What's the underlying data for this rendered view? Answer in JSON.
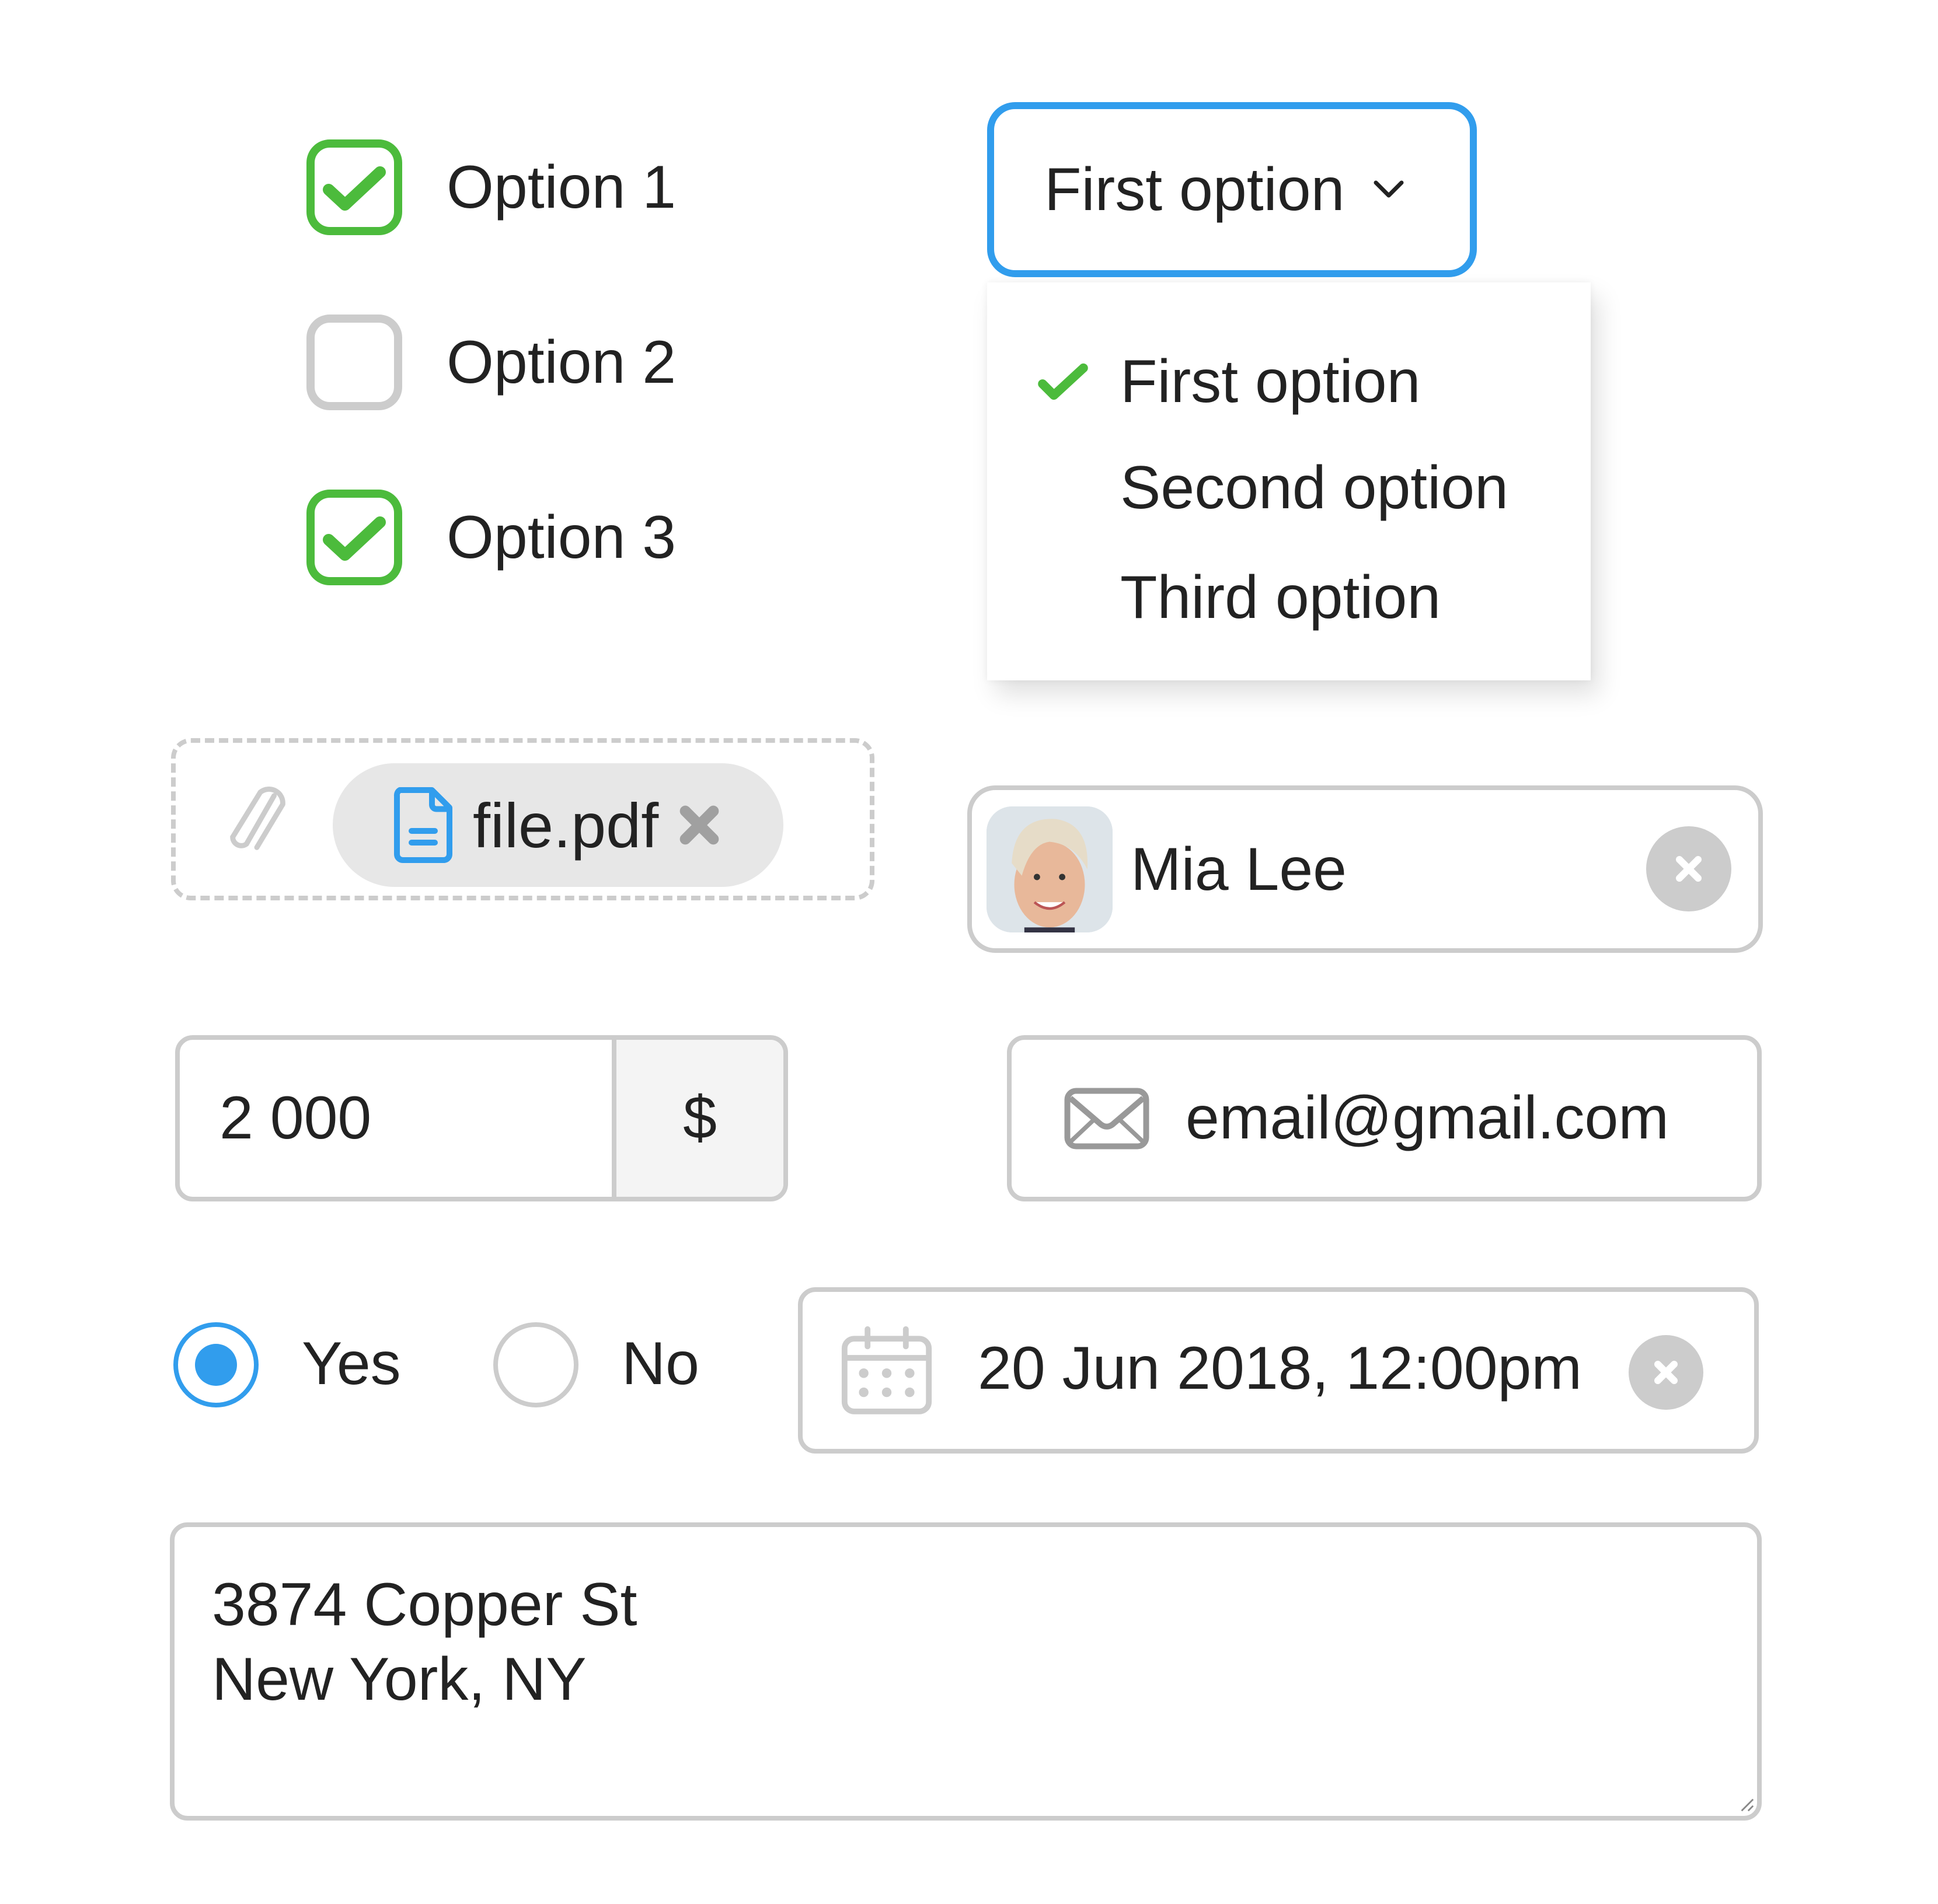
{
  "colors": {
    "accent_blue": "#319ded",
    "check_green": "#4cbb3c",
    "border_gray": "#cccccc",
    "icon_gray": "#999999",
    "chip_bg": "#e7e7e7",
    "addon_bg": "#f4f4f4",
    "text": "#222222"
  },
  "checkboxes": [
    {
      "label": "Option 1",
      "checked": true
    },
    {
      "label": "Option 2",
      "checked": false
    },
    {
      "label": "Option 3",
      "checked": true
    }
  ],
  "dropdown": {
    "selected": "First option",
    "icon": "chevron-down-icon",
    "options": [
      {
        "label": "First option",
        "selected": true
      },
      {
        "label": "Second option",
        "selected": false
      },
      {
        "label": "Third option",
        "selected": false
      }
    ]
  },
  "file_upload": {
    "icon": "paperclip-icon",
    "file": {
      "name": "file.pdf",
      "icon": "document-icon",
      "remove_icon": "close-icon"
    }
  },
  "person_input": {
    "name": "Mia Lee",
    "avatar": "avatar-photo",
    "clear_icon": "close-circle-icon"
  },
  "amount_input": {
    "value": "2 000",
    "currency": "$"
  },
  "email_input": {
    "icon": "envelope-icon",
    "value": "email@gmail.com"
  },
  "radio_group": {
    "options": [
      {
        "label": "Yes",
        "selected": true
      },
      {
        "label": "No",
        "selected": false
      }
    ]
  },
  "datetime_input": {
    "icon": "calendar-icon",
    "value": "20 Jun 2018, 12:00pm",
    "clear_icon": "close-circle-icon"
  },
  "address_textarea": {
    "lines": [
      "3874 Copper St",
      "New York, NY"
    ]
  }
}
